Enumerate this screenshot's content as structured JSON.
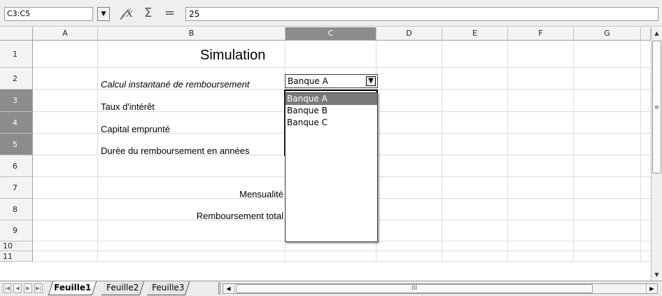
{
  "formula_bar": {
    "name_box": "C3:C5",
    "function_wizard_icon": "fx-icon",
    "sum_icon": "sigma-icon",
    "equal_icon": "equal-icon",
    "function_wizard_glyph": "𝒻x",
    "sum_glyph": "Σ",
    "equal_glyph": "=",
    "input_value": "25"
  },
  "columns": [
    "A",
    "B",
    "C",
    "D",
    "E",
    "F",
    "G"
  ],
  "rows": [
    "1",
    "2",
    "3",
    "4",
    "5",
    "6",
    "7",
    "8",
    "9",
    "10",
    "11"
  ],
  "selected_column": "C",
  "selected_rows": [
    "3",
    "4",
    "5"
  ],
  "cells": {
    "b1": "Simulation",
    "b2": "Calcul instantané de remboursement",
    "b3": "Taux d'intérêt",
    "b4": "Capital emprunté",
    "b5": "Durée du remboursement en années",
    "b7": "Mensualité",
    "b8": "Remboursement total"
  },
  "validity_dropdown": {
    "value": "Banque A",
    "options": [
      "Banque A",
      "Banque B",
      "Banque C"
    ],
    "highlighted_index": 0
  },
  "sheet_tabs": [
    "Feuille1",
    "Feuille2",
    "Feuille3"
  ],
  "active_sheet": "Feuille1",
  "colors": {
    "selected_header": "#8c8c8c",
    "highlight": "#7a7a7a"
  }
}
